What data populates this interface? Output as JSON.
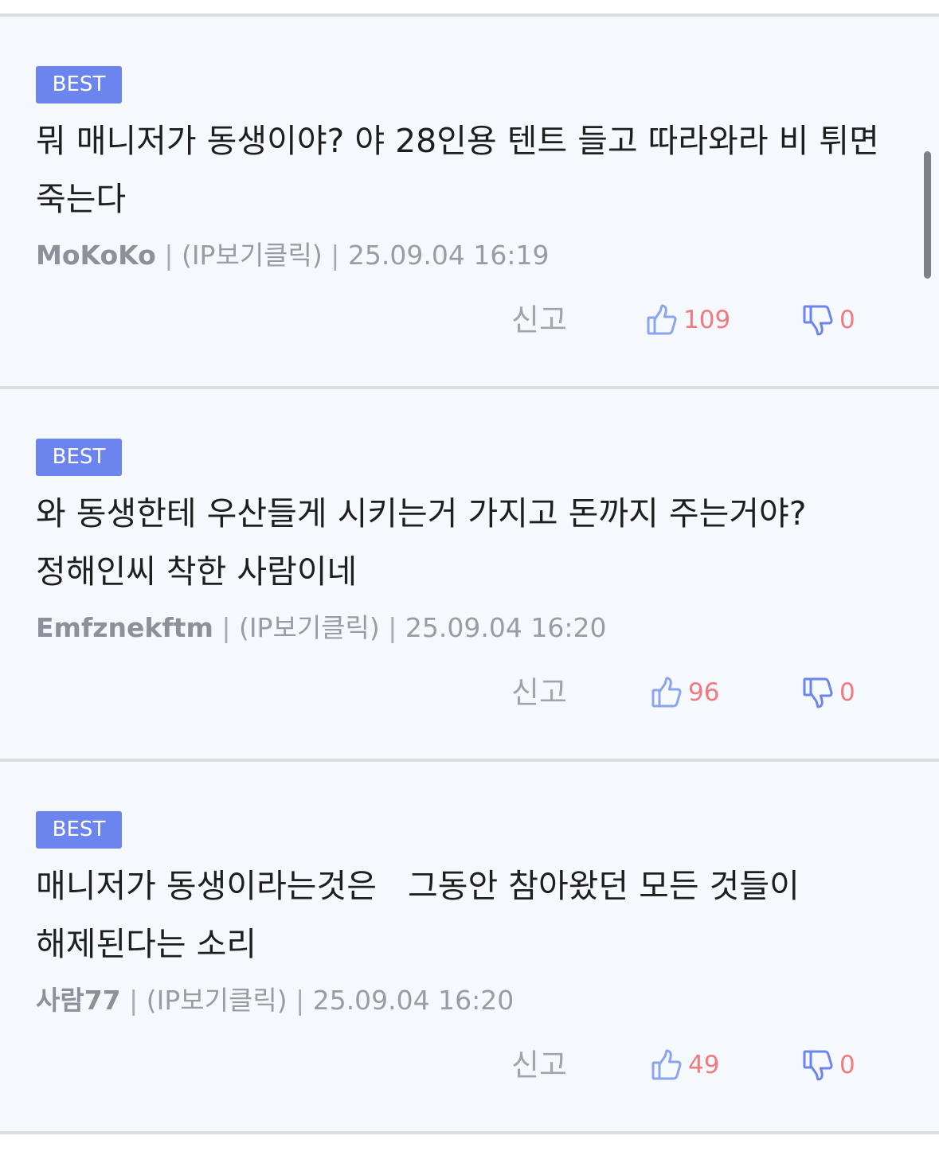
{
  "comments": [
    {
      "badge": "BEST",
      "text": "뭐 매니저가 동생이야? 야 28인용 텐트 들고 따라와라 비 튀면 죽는다",
      "author": "MoKoKo",
      "ip_label": "(IP보기클릭)",
      "timestamp": "25.09.04 16:19",
      "report_label": "신고",
      "likes": "109",
      "dislikes": "0"
    },
    {
      "badge": "BEST",
      "text": "와 동생한테 우산들게 시키는거 가지고 돈까지 주는거야? 정해인씨 착한 사람이네",
      "author": "Emfznekftm",
      "ip_label": "(IP보기클릭)",
      "timestamp": "25.09.04 16:20",
      "report_label": "신고",
      "likes": "96",
      "dislikes": "0"
    },
    {
      "badge": "BEST",
      "text": "매니저가 동생이라는것은   그동안 참아왔던 모든 것들이 해제된다는 소리",
      "author": "사람77",
      "ip_label": "(IP보기클릭)",
      "timestamp": "25.09.04 16:20",
      "report_label": "신고",
      "likes": "49",
      "dislikes": "0"
    }
  ],
  "separator": "|",
  "colors": {
    "badge_bg": "#6b84ee",
    "count": "#ef7b7f",
    "thumb_up_icon": "#8aa4ee",
    "thumb_down_icon": "#6b84ee",
    "card_bg": "#f5f8fd"
  }
}
